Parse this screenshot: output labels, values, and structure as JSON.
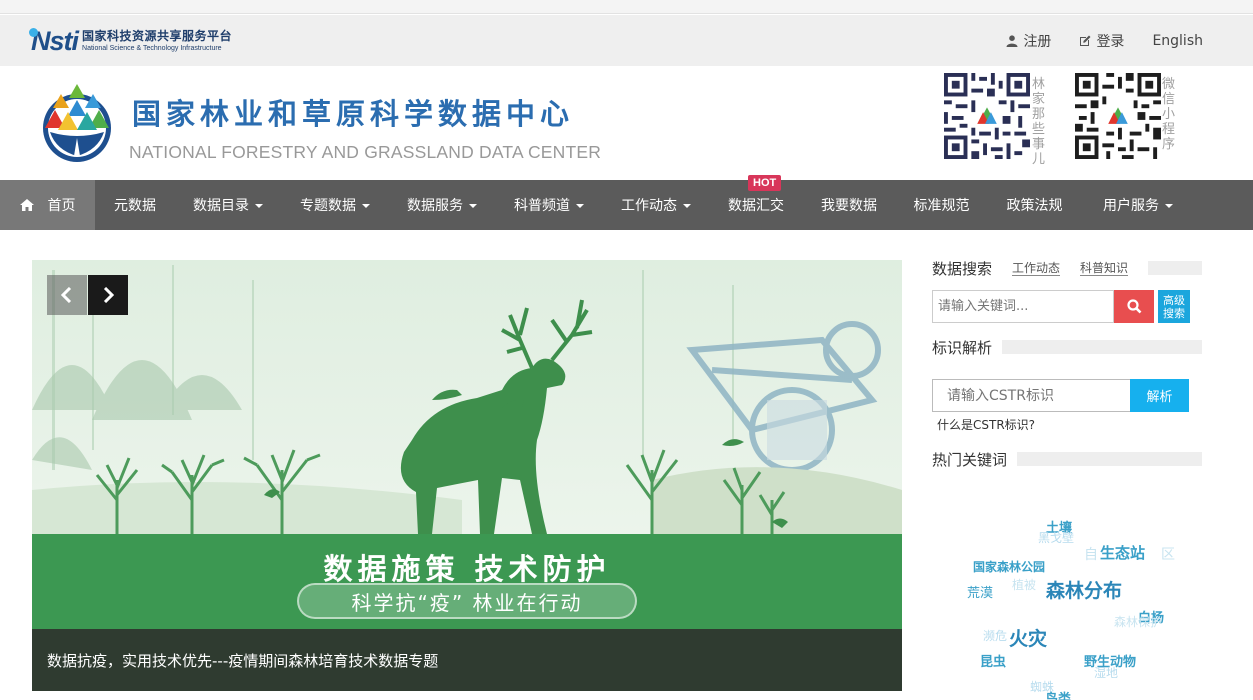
{
  "topbar": {
    "logo_mark": "Nsti",
    "logo_cn": "国家科技资源共享服务平台",
    "logo_en": "National Science & Technology Infrastructure",
    "register": "注册",
    "login": "登录",
    "english": "English"
  },
  "header": {
    "title_cn": "国家林业和草原科学数据中心",
    "title_en": "NATIONAL FORESTRY AND GRASSLAND DATA CENTER",
    "qr1_caption": "林家那些事儿",
    "qr2_caption": "微信小程序"
  },
  "nav": {
    "items": [
      {
        "label": "首页"
      },
      {
        "label": "元数据"
      },
      {
        "label": "数据目录"
      },
      {
        "label": "专题数据"
      },
      {
        "label": "数据服务"
      },
      {
        "label": "科普频道"
      },
      {
        "label": "工作动态"
      },
      {
        "label": "数据汇交",
        "badge": "HOT"
      },
      {
        "label": "我要数据"
      },
      {
        "label": "标准规范"
      },
      {
        "label": "政策法规"
      },
      {
        "label": "用户服务"
      }
    ]
  },
  "banner": {
    "slogan": "数据施策 技术防护",
    "subslogan": "科学抗“疫” 林业在行动",
    "caption": "数据抗疫，实用技术优先---疫情期间森林培育技术数据专题"
  },
  "sidebar": {
    "search_title": "数据搜索",
    "tab_news": "工作动态",
    "tab_science": "科普知识",
    "search_placeholder": "请输入关键词...",
    "advanced_search": "高级搜索",
    "resolve_title": "标识解析",
    "cstr_placeholder": "请输入CSTR标识",
    "resolve_button": "解析",
    "cstr_help": "什么是CSTR标识?",
    "hot_title": "热门关键词"
  },
  "keywords": [
    {
      "text": "土壤",
      "color": "#3aa0c8"
    },
    {
      "text": "黑戈壁",
      "color": "#b8dcee"
    },
    {
      "text": "自",
      "color": "#c8e4f0"
    },
    {
      "text": "生态站",
      "color": "#3aa0c8"
    },
    {
      "text": "区",
      "color": "#c8e4f0"
    },
    {
      "text": "国家森林公园",
      "color": "#3aa0c8"
    },
    {
      "text": "荒漠",
      "color": "#3aa0c8"
    },
    {
      "text": "植被",
      "color": "#c8e4f0"
    },
    {
      "text": "森林分布",
      "color": "#2b86b8"
    },
    {
      "text": "白杨",
      "color": "#3aa0c8"
    },
    {
      "text": "森林保护",
      "color": "#c8e4f0"
    },
    {
      "text": "濒危",
      "color": "#b8dcee"
    },
    {
      "text": "火灾",
      "color": "#2b86b8"
    },
    {
      "text": "昆虫",
      "color": "#3aa0c8"
    },
    {
      "text": "野生动物",
      "color": "#3aa0c8"
    },
    {
      "text": "湿地",
      "color": "#b8dcee"
    },
    {
      "text": "蜘蛛",
      "color": "#b8dcee"
    },
    {
      "text": "鸟类",
      "color": "#3aa0c8"
    }
  ]
}
